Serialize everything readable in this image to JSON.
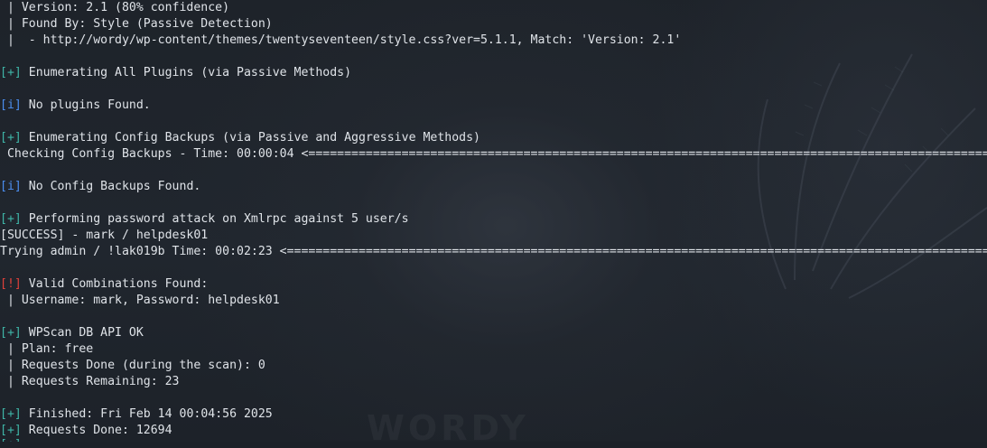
{
  "terminal": {
    "version_line": " | Version: 2.1 (80% confidence)",
    "found_by_line": " | Found By: Style (Passive Detection)",
    "match_line": " |  - http://wordy/wp-content/themes/twentyseventeen/style.css?ver=5.1.1, Match: 'Version: 2.1'",
    "tag_plus": "[+]",
    "tag_info": "[i]",
    "tag_warn": "[!]",
    "enum_plugins": " Enumerating All Plugins (via Passive Methods)",
    "no_plugins": " No plugins Found.",
    "enum_backups": " Enumerating Config Backups (via Passive and Aggressive Methods)",
    "checking_backups": " Checking Config Backups - Time: 00:00:04 <",
    "progress_bar_1": "====================================================================================================",
    "no_backups": " No Config Backups Found.",
    "password_attack": " Performing password attack on Xmlrpc against 5 user/s",
    "success_line": "[SUCCESS] - mark / helpdesk01",
    "trying_line": "Trying admin / !lak019b Time: 00:02:23 <",
    "progress_bar_2": "==========================================================================================================",
    "valid_combos": " Valid Combinations Found:",
    "credentials": " | Username: mark, Password: helpdesk01",
    "api_ok": " WPScan DB API OK",
    "plan": " | Plan: free",
    "requests_done_scan": " | Requests Done (during the scan): 0",
    "requests_remaining": " | Requests Remaining: 23",
    "finished": " Finished: Fri Feb 14 00:04:56 2025",
    "requests_done": " Requests Done: 12694"
  },
  "wallpaper": {
    "text": "WORDY"
  },
  "colors": {
    "background": "#1c2128",
    "text": "#dfe3e8",
    "plus_tag": "#3fb6a8",
    "info_tag": "#4b8ef0",
    "warn_tag": "#e0413a"
  }
}
